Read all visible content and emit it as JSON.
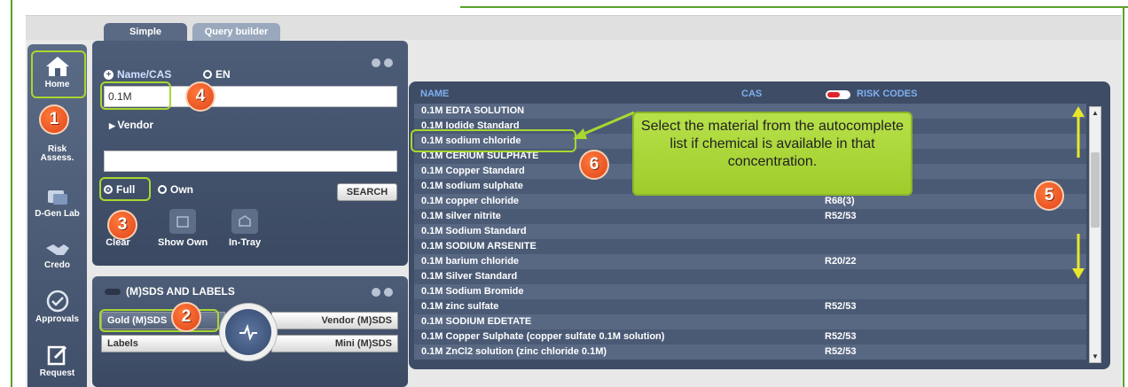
{
  "nav": {
    "items": [
      {
        "label": "Home",
        "icon": "home-icon"
      },
      {
        "label": "Risk\nAssess.",
        "icon": "risk-icon"
      },
      {
        "label": "D-Gen Lab",
        "icon": "lab-icon"
      },
      {
        "label": "Credo",
        "icon": "handshake-icon"
      },
      {
        "label": "Approvals",
        "icon": "check-icon"
      },
      {
        "label": "Request",
        "icon": "edit-icon"
      }
    ]
  },
  "tabs": {
    "simple": "Simple",
    "query_builder": "Query builder"
  },
  "search": {
    "name_cas_label": "Name/CAS",
    "en_label": "EN",
    "query_value": "0.1M",
    "vendor_label": "Vendor",
    "vendor_value": "",
    "full_label": "Full",
    "own_label": "Own",
    "search_button": "SEARCH",
    "tools": [
      {
        "label": "Clear",
        "icon": "clear-icon"
      },
      {
        "label": "Show Own",
        "icon": "folder-icon"
      },
      {
        "label": "In-Tray",
        "icon": "in-tray-icon"
      }
    ]
  },
  "sds": {
    "title": "(M)SDS AND LABELS",
    "gold": "Gold (M)SDS",
    "vendor": "Vendor (M)SDS",
    "labels": "Labels",
    "mini": "Mini (M)SDS"
  },
  "results": {
    "col_name": "NAME",
    "col_cas": "CAS",
    "col_risk": "RISK CODES",
    "rows": [
      {
        "name": "0.1M EDTA SOLUTION",
        "risk": ""
      },
      {
        "name": "0.1M Iodide Standard",
        "risk": ""
      },
      {
        "name": "0.1M sodium chloride",
        "risk": ""
      },
      {
        "name": "0.1M CERIUM SULPHATE",
        "risk": ""
      },
      {
        "name": "0.1M Copper Standard",
        "risk": ""
      },
      {
        "name": "0.1M sodium sulphate",
        "risk": ""
      },
      {
        "name": "0.1M copper chloride",
        "risk": "R68(3)"
      },
      {
        "name": "0.1M silver nitrite",
        "risk": "R52/53"
      },
      {
        "name": "0.1M Sodium Standard",
        "risk": ""
      },
      {
        "name": "0.1M SODIUM ARSENITE",
        "risk": ""
      },
      {
        "name": "0.1M barium chloride",
        "risk": "R20/22"
      },
      {
        "name": "0.1M Silver Standard",
        "risk": ""
      },
      {
        "name": "0.1M Sodium Bromide",
        "risk": ""
      },
      {
        "name": "0.1M zinc sulfate",
        "risk": "R52/53"
      },
      {
        "name": "0.1M SODIUM EDETATE",
        "risk": ""
      },
      {
        "name": "0.1M Copper Sulphate (copper sulfate 0.1M solution)",
        "risk": "R52/53"
      },
      {
        "name": "0.1M ZnCl2 solution (zinc chloride 0.1M)",
        "risk": "R52/53"
      }
    ]
  },
  "annotations": {
    "badges": [
      "1",
      "2",
      "3",
      "4",
      "5",
      "6"
    ],
    "callout": "Select the material from the autocomplete list if chemical is available in that concentration."
  },
  "colors": {
    "accent_green": "#a8d72f",
    "badge_orange": "#e0451a",
    "panel": "#4d5d78",
    "header_blue": "#7fb0f0"
  }
}
